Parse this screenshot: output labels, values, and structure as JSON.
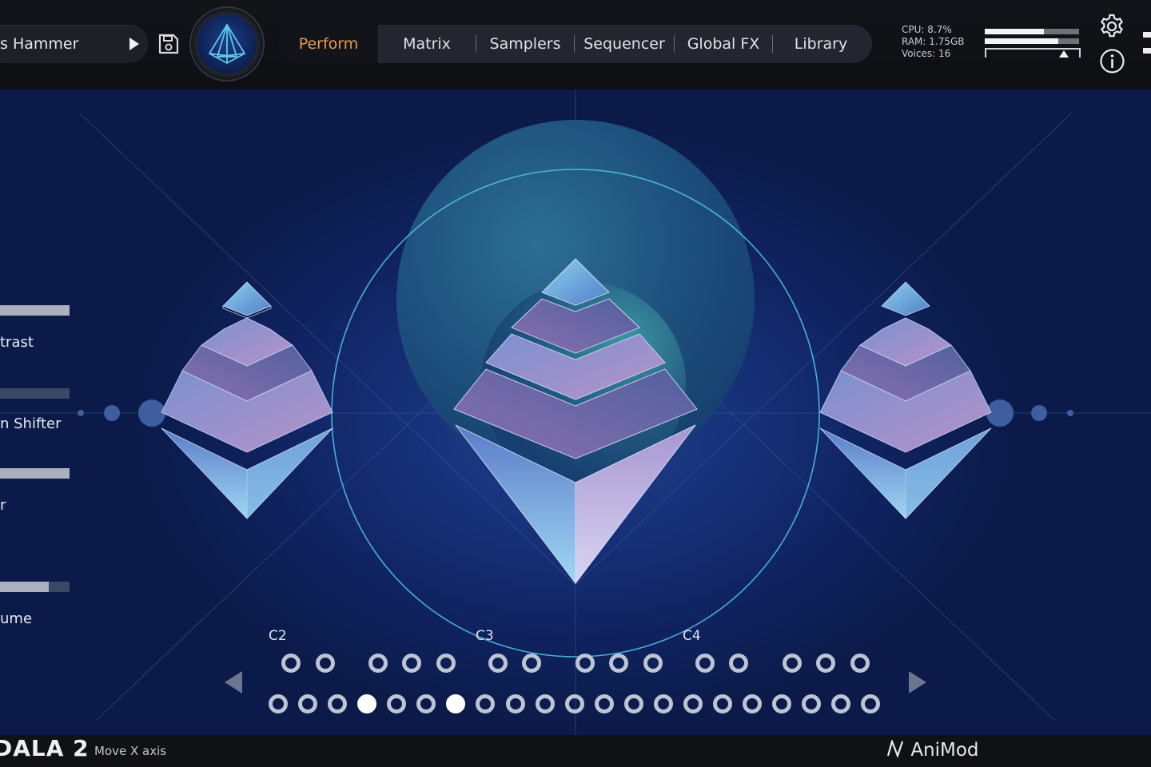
{
  "header": {
    "preset_name": "s Hammer",
    "play_icon": "play-icon",
    "save_icon": "save-icon",
    "logo_icon": "pyramid-logo-icon",
    "tabs": [
      {
        "label": "Perform",
        "active": true
      },
      {
        "label": "Matrix",
        "active": false
      },
      {
        "label": "Samplers",
        "active": false
      },
      {
        "label": "Sequencer",
        "active": false
      },
      {
        "label": "Global FX",
        "active": false
      },
      {
        "label": "Library",
        "active": false
      }
    ],
    "active_tab_color": "#e79a4e",
    "sysinfo": {
      "cpu": "CPU: 8.7%",
      "ram": "RAM: 1.75GB",
      "voices": "Voices: 16"
    },
    "meter": {
      "level_1": 0.63,
      "level_2": 0.78,
      "slider": 0.84
    },
    "settings_icon": "gear-icon",
    "info_icon": "info-icon"
  },
  "macros": [
    {
      "label": "trast",
      "value": 1.0
    },
    {
      "label": "n Shifter",
      "value": 0.0
    },
    {
      "label": "r",
      "value": 1.0
    },
    {
      "label": "ume",
      "value": 0.7
    }
  ],
  "keyboard": {
    "octave_labels": [
      "C2",
      "C3",
      "C4"
    ],
    "black_keys": 15,
    "white_keys": 21,
    "active_white_keys": [
      3,
      6
    ],
    "prev_icon": "triangle-left-icon",
    "next_icon": "triangle-right-icon"
  },
  "footer": {
    "brand": "DALA 2",
    "status": "Move X axis",
    "company": "AniMod"
  }
}
